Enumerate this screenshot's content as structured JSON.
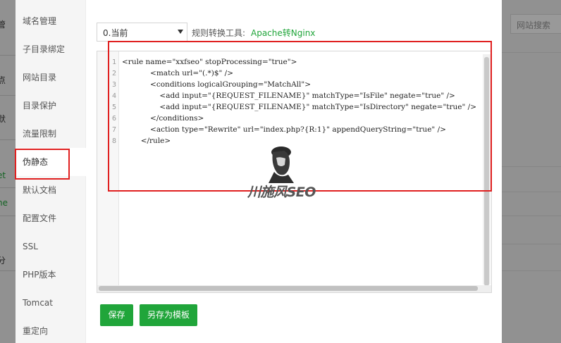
{
  "background": {
    "left_fragments": [
      "管",
      "点",
      "默",
      "et",
      "ne",
      "分"
    ],
    "search_placeholder": "网站搜索"
  },
  "sidebar": {
    "items": [
      {
        "label": "域名管理"
      },
      {
        "label": "子目录绑定"
      },
      {
        "label": "网站目录"
      },
      {
        "label": "目录保护"
      },
      {
        "label": "流量限制"
      },
      {
        "label": "伪静态",
        "active": true
      },
      {
        "label": "默认文档"
      },
      {
        "label": "配置文件"
      },
      {
        "label": "SSL"
      },
      {
        "label": "PHP版本"
      },
      {
        "label": "Tomcat"
      },
      {
        "label": "重定向"
      }
    ]
  },
  "toolbar": {
    "selected_option": "0.当前",
    "tool_label": "规则转换工具:",
    "tool_link": "Apache转Nginx"
  },
  "editor": {
    "line_numbers": [
      "1",
      "2",
      "3",
      "4",
      "5",
      "6",
      "7",
      "8"
    ],
    "lines": [
      "<rule name=\"xxfseo\" stopProcessing=\"true\">",
      "            <match url=\"(.*)$\" />",
      "            <conditions logicalGrouping=\"MatchAll\">",
      "                <add input=\"{REQUEST_FILENAME}\" matchType=\"IsFile\" negate=\"true\" />",
      "                <add input=\"{REQUEST_FILENAME}\" matchType=\"IsDirectory\" negate=\"true\" />",
      "            </conditions>",
      "            <action type=\"Rewrite\" url=\"index.php?{R:1}\" appendQueryString=\"true\" />",
      "        </rule>"
    ]
  },
  "buttons": {
    "save": "保存",
    "save_as_template": "另存为模板"
  },
  "watermark": {
    "text": "川施风SEO"
  },
  "colors": {
    "accent": "#20a53a",
    "highlight": "#e02020"
  }
}
